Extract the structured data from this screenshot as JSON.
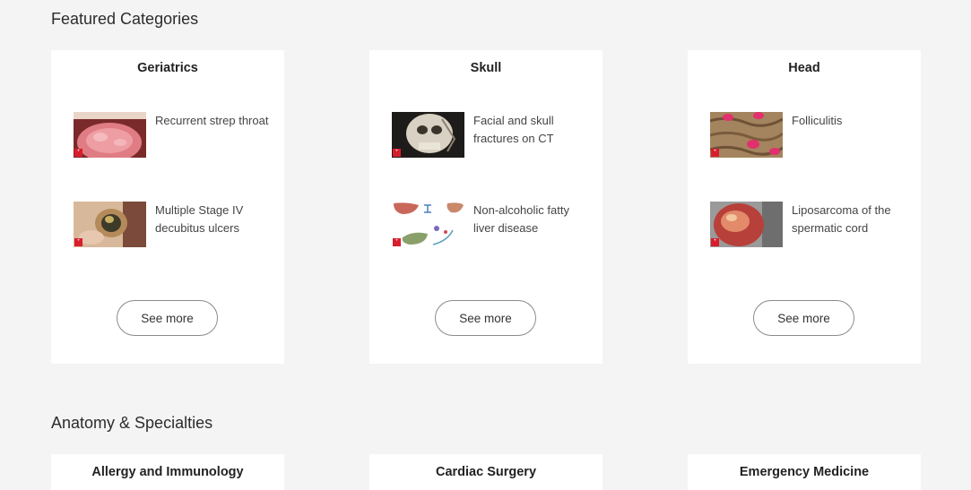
{
  "featured": {
    "heading": "Featured Categories",
    "cards": [
      {
        "title": "Geriatrics",
        "items": [
          {
            "label": "Recurrent strep throat",
            "icon": "tongue-thumbnail"
          },
          {
            "label": "Multiple Stage IV decubitus ulcers",
            "icon": "ulcer-thumbnail"
          }
        ],
        "see_more": "See more"
      },
      {
        "title": "Skull",
        "items": [
          {
            "label": "Facial and skull fractures on CT",
            "icon": "skull-ct-thumbnail"
          },
          {
            "label": "Non-alcoholic fatty liver disease",
            "icon": "liver-diagram-thumbnail"
          }
        ],
        "see_more": "See more"
      },
      {
        "title": "Head",
        "items": [
          {
            "label": "Folliculitis",
            "icon": "scalp-thumbnail"
          },
          {
            "label": "Liposarcoma of the spermatic cord",
            "icon": "tumor-thumbnail"
          }
        ],
        "see_more": "See more"
      }
    ]
  },
  "anatomy": {
    "heading": "Anatomy & Specialties",
    "cards": [
      {
        "title": "Allergy and Immunology"
      },
      {
        "title": "Cardiac Surgery"
      },
      {
        "title": "Emergency Medicine"
      }
    ]
  },
  "colors": {
    "background": "#f4f4f4",
    "card": "#ffffff",
    "badge": "#d81e2c"
  }
}
